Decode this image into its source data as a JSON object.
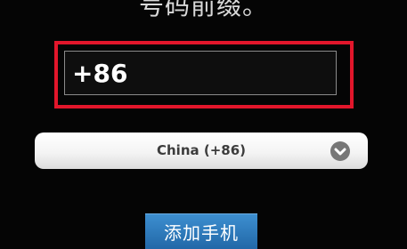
{
  "instructions": {
    "partial_text": "号码前缀。"
  },
  "phone_field": {
    "value": "+86",
    "highlight_color": "#e2162b"
  },
  "country_select": {
    "selected": "China (+86)",
    "icon": "chevron-down-circle-icon"
  },
  "actions": {
    "add_phone_label": "添加手机",
    "button_color": "#2a77bb"
  }
}
